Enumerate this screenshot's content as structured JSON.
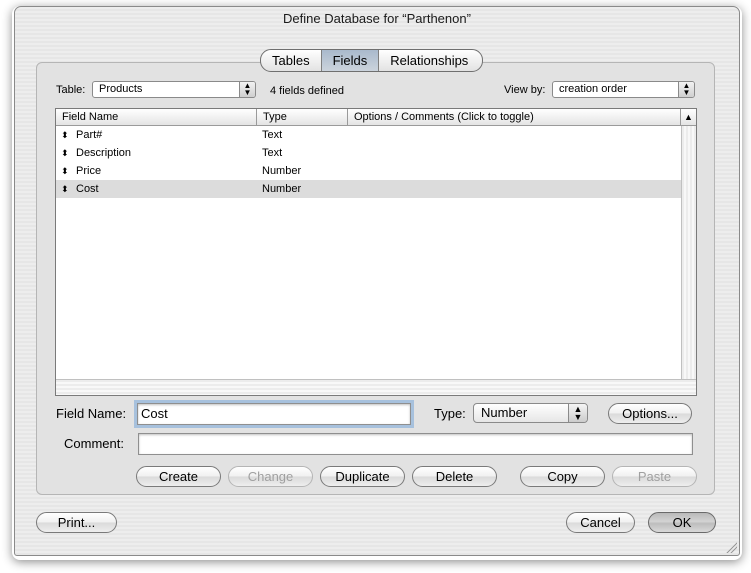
{
  "window": {
    "title": "Define Database for “Parthenon”"
  },
  "tabs": [
    {
      "label": "Tables",
      "active": false
    },
    {
      "label": "Fields",
      "active": true
    },
    {
      "label": "Relationships",
      "active": false
    }
  ],
  "table_selector": {
    "label": "Table:",
    "value": "Products",
    "icon": "popup-arrows-icon"
  },
  "fields_count_text": "4 fields defined",
  "view_by": {
    "label": "View by:",
    "value": "creation order"
  },
  "field_list": {
    "columns": [
      "Field Name",
      "Type",
      "Options / Comments   (Click to toggle)"
    ],
    "rows": [
      {
        "name": "Part#",
        "type": "Text"
      },
      {
        "name": "Description",
        "type": "Text"
      },
      {
        "name": "Price",
        "type": "Number"
      },
      {
        "name": "Cost",
        "type": "Number",
        "selected": true
      }
    ]
  },
  "form": {
    "field_name_label": "Field Name:",
    "field_name_value": "Cost",
    "type_label": "Type:",
    "type_value": "Number",
    "options_button": "Options...",
    "comment_label": "Comment:",
    "comment_value": ""
  },
  "actions": {
    "create": "Create",
    "change": "Change",
    "duplicate": "Duplicate",
    "delete": "Delete",
    "copy": "Copy",
    "paste": "Paste"
  },
  "footer": {
    "print": "Print...",
    "cancel": "Cancel",
    "ok": "OK"
  },
  "colors": {
    "window_bg": "#ececec",
    "selection_row": "#dcdcdc",
    "active_tab": "#a9b9cc",
    "focus_ring": "#a7c1dd"
  }
}
